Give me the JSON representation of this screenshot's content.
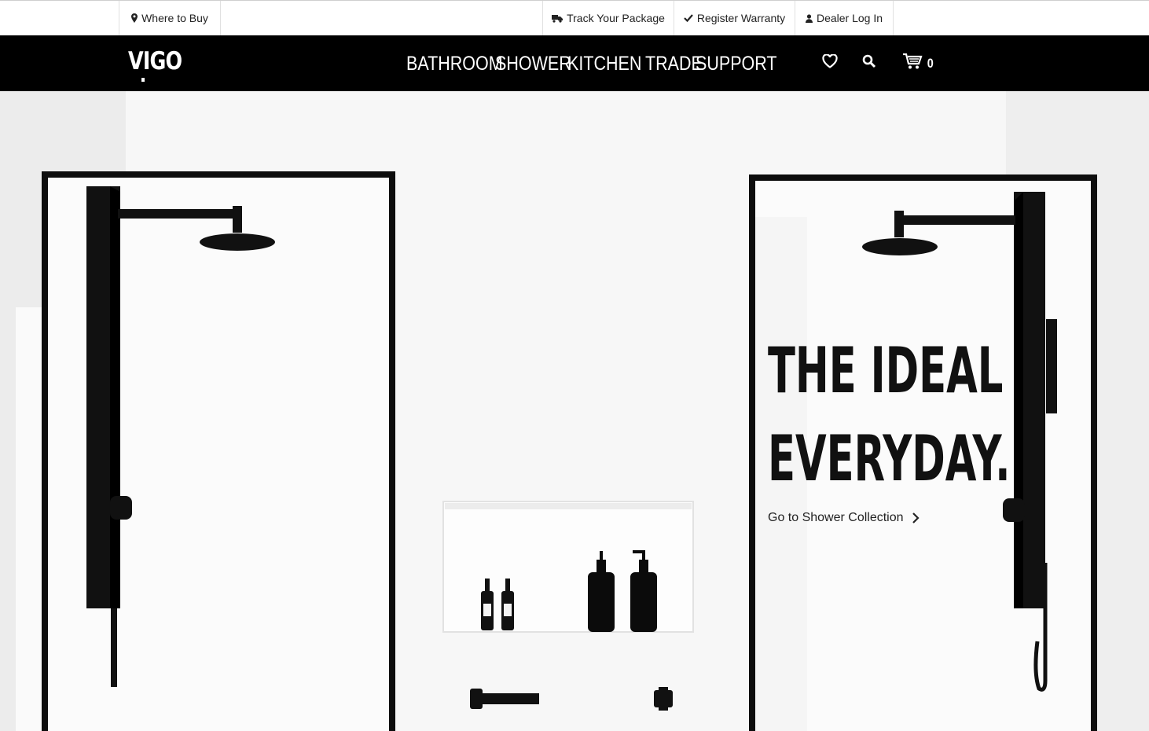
{
  "utility_bar": {
    "where_to_buy": "Where to Buy",
    "track_package": "Track Your Package",
    "register_warranty": "Register Warranty",
    "dealer_login": "Dealer Log In"
  },
  "brand": {
    "logo_text": "VIGO"
  },
  "nav": {
    "items": [
      {
        "label": "BATHROOM"
      },
      {
        "label": "SHOWER"
      },
      {
        "label": "KITCHEN"
      },
      {
        "label": "TRADE"
      },
      {
        "label": "SUPPORT"
      }
    ],
    "icons": [
      "heart-icon",
      "search-icon",
      "cart-icon"
    ],
    "cart_count": "0"
  },
  "hero": {
    "title_line1": "THE IDEAL",
    "title_line2": "EVERYDAY.",
    "cta_label": "Go to Shower Collection"
  },
  "colors": {
    "nav_background": "#000000",
    "utility_background": "#ffffff",
    "hero_background": "#f3f3f3",
    "text_dark": "#111111"
  }
}
